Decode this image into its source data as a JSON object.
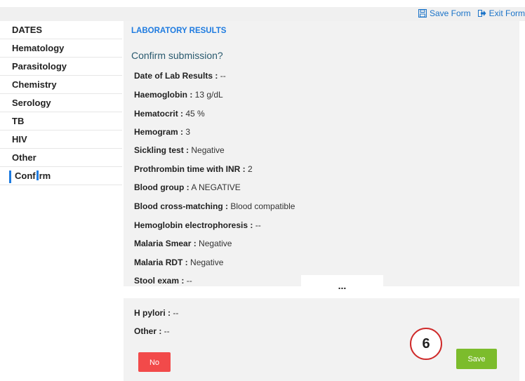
{
  "topbar": {
    "save_label": "Save Form",
    "exit_label": "Exit Form"
  },
  "sidebar": {
    "items": [
      {
        "label": "DATES"
      },
      {
        "label": "Hematology"
      },
      {
        "label": "Parasitology"
      },
      {
        "label": "Chemistry"
      },
      {
        "label": "Serology"
      },
      {
        "label": "TB"
      },
      {
        "label": "HIV"
      },
      {
        "label": "Other"
      },
      {
        "label_pre": "Conf",
        "label_post": "rm"
      }
    ]
  },
  "main": {
    "section_title": "LABORATORY RESULTS",
    "confirm_question": "Confirm submission?",
    "results": [
      {
        "key": "Date of Lab Results :",
        "value": " --"
      },
      {
        "key": "Haemoglobin :",
        "value": " 13 g/dL"
      },
      {
        "key": "Hematocrit :",
        "value": " 45 %"
      },
      {
        "key": "Hemogram :",
        "value": " 3"
      },
      {
        "key": "Sickling test :",
        "value": " Negative"
      },
      {
        "key": "Prothrombin time with INR :",
        "value": " 2"
      },
      {
        "key": "Blood group :",
        "value": " A NEGATIVE"
      },
      {
        "key": "Blood cross-matching :",
        "value": " Blood compatible"
      },
      {
        "key": "Hemoglobin electrophoresis :",
        "value": " --"
      },
      {
        "key": "Malaria Smear :",
        "value": " Negative"
      },
      {
        "key": "Malaria RDT :",
        "value": " Negative"
      },
      {
        "key": "Stool exam :",
        "value": " --"
      }
    ],
    "ellipsis": "...",
    "results_bottom": [
      {
        "key": "H pylori :",
        "value": " --"
      },
      {
        "key": "Other :",
        "value": " --"
      }
    ],
    "no_label": "No",
    "save_label": "Save",
    "step_number": "6"
  },
  "colors": {
    "accent": "#1e7be0",
    "no_button": "#f24a4a",
    "save_button": "#7cbc2c",
    "badge_ring": "#cf2a2a"
  }
}
